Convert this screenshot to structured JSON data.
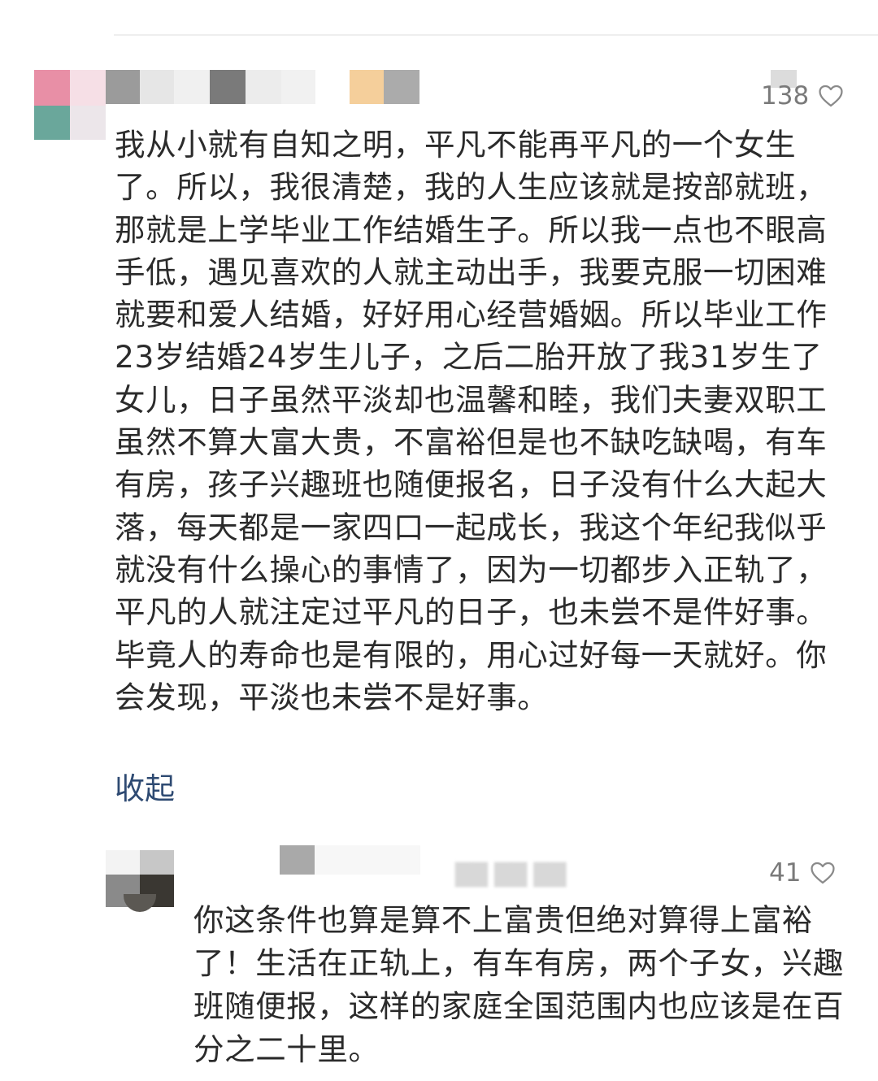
{
  "comments": [
    {
      "likes": "138",
      "text": "我从小就有自知之明，平凡不能再平凡的一个女生了。所以，我很清楚，我的人生应该就是按部就班，那就是上学毕业工作结婚生子。所以我一点也不眼高手低，遇见喜欢的人就主动出手，我要克服一切困难就要和爱人结婚，好好用心经营婚姻。所以毕业工作23岁结婚24岁生儿子，之后二胎开放了我31岁生了女儿，日子虽然平淡却也温馨和睦，我们夫妻双职工虽然不算大富大贵，不富裕但是也不缺吃缺喝，有车有房，孩子兴趣班也随便报名，日子没有什么大起大落，每天都是一家四口一起成长，我这个年纪我似乎就没有什么操心的事情了，因为一切都步入正轨了，平凡的人就注定过平凡的日子，也未尝不是件好事。毕竟人的寿命也是有限的，用心过好每一天就好。你会发现，平淡也未尝不是好事。",
      "collapse_label": "收起"
    },
    {
      "likes": "41",
      "text": "你这条件也算是算不上富贵但绝对算得上富裕了！生活在正轨上，有车有房，两个子女，兴趣班随便报，这样的家庭全国范围内也应该是在百分之二十里。"
    }
  ],
  "colors": {
    "text": "#2b2b2b",
    "link": "#2e4a72",
    "meta": "#7a7a7a"
  },
  "icons": {
    "like": "heart-outline-icon"
  }
}
